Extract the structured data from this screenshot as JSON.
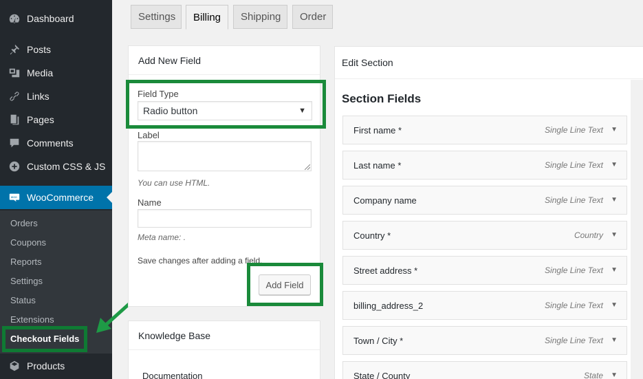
{
  "sidebar": {
    "items": [
      {
        "label": "Dashboard",
        "icon": "dashboard-icon"
      },
      {
        "label": "Posts",
        "icon": "pin-icon"
      },
      {
        "label": "Media",
        "icon": "media-icon"
      },
      {
        "label": "Links",
        "icon": "link-icon"
      },
      {
        "label": "Pages",
        "icon": "pages-icon"
      },
      {
        "label": "Comments",
        "icon": "comment-icon"
      },
      {
        "label": "Custom CSS & JS",
        "icon": "plus-circle-icon"
      },
      {
        "label": "WooCommerce",
        "icon": "woo-icon"
      },
      {
        "label": "Products",
        "icon": "products-icon"
      }
    ],
    "submenu": [
      "Orders",
      "Coupons",
      "Reports",
      "Settings",
      "Status",
      "Extensions",
      "Checkout Fields"
    ]
  },
  "tabs": [
    "Settings",
    "Billing",
    "Shipping",
    "Order"
  ],
  "add_field": {
    "title": "Add New Field",
    "field_type_label": "Field Type",
    "field_type_value": "Radio button",
    "label_label": "Label",
    "label_hint": "You can use HTML.",
    "name_label": "Name",
    "meta_hint": "Meta name: .",
    "save_note": "Save changes after adding a field.",
    "add_button": "Add Field"
  },
  "knowledge_base": {
    "title": "Knowledge Base",
    "documentation": "Documentation"
  },
  "edit_section": {
    "title": "Edit Section",
    "fields_title": "Section Fields",
    "fields": [
      {
        "name": "First name *",
        "type": "Single Line Text"
      },
      {
        "name": "Last name *",
        "type": "Single Line Text"
      },
      {
        "name": "Company name",
        "type": "Single Line Text"
      },
      {
        "name": "Country *",
        "type": "Country"
      },
      {
        "name": "Street address *",
        "type": "Single Line Text"
      },
      {
        "name": "billing_address_2",
        "type": "Single Line Text"
      },
      {
        "name": "Town / City *",
        "type": "Single Line Text"
      },
      {
        "name": "State / County",
        "type": "State"
      }
    ]
  },
  "colors": {
    "sidebar_bg": "#23282d",
    "submenu_bg": "#32373c",
    "woo_accent": "#0073aa",
    "highlight_green": "#1a8a3a"
  }
}
